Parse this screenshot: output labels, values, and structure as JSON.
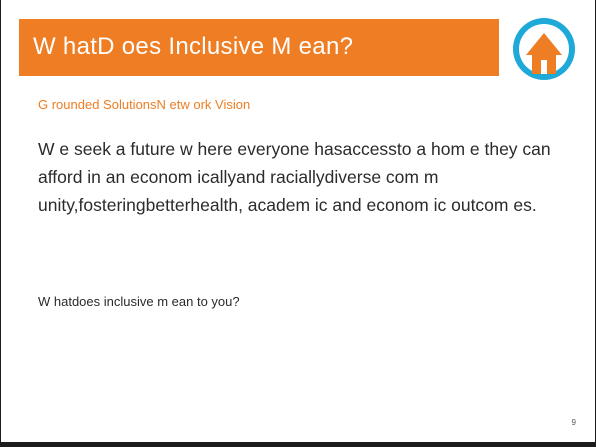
{
  "slide": {
    "title": "W hatD oes Inclusive M ean?",
    "subtitle": "G rounded SolutionsN etw ork Vision",
    "vision": "W e seek a future w here everyone hasaccessto a hom e they can afford in an econom icallyand raciallydiverse com m unity,fosteringbetterhealth, academ ic and econom ic outcom es.",
    "question": "W hatdoes inclusive m ean to you?",
    "page_number": "9"
  },
  "colors": {
    "accent": "#ee7d23",
    "logo_blue": "#1ea9d9",
    "text": "#2b2b2b",
    "border": "#1c1c1c"
  },
  "icons": {
    "logo": "house-logo-icon"
  }
}
